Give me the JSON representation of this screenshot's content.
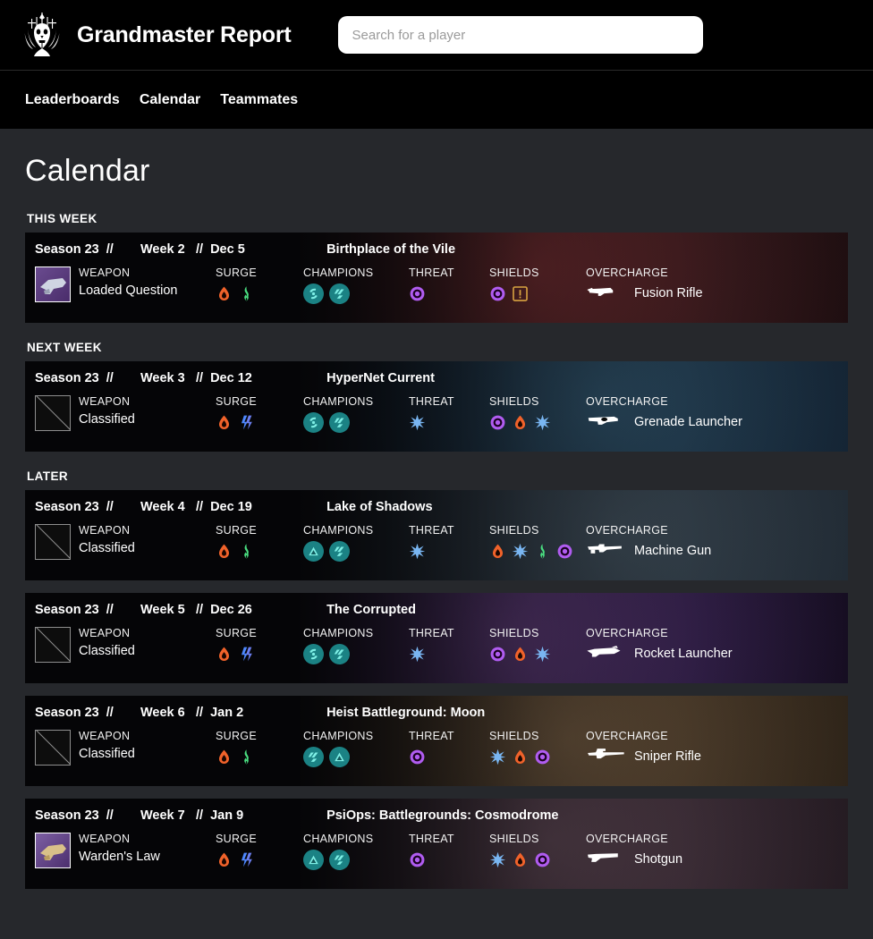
{
  "header": {
    "logo_icon": "grandmaster-crest-icon",
    "brand": "Grandmaster Report",
    "search_placeholder": "Search for a player",
    "search_value": ""
  },
  "nav": {
    "items": [
      {
        "label": "Leaderboards"
      },
      {
        "label": "Calendar"
      },
      {
        "label": "Teammates"
      }
    ]
  },
  "page": {
    "title": "Calendar"
  },
  "labels": {
    "weapon": "WEAPON",
    "surge": "SURGE",
    "champions": "CHAMPIONS",
    "threat": "THREAT",
    "shields": "SHIELDS",
    "overcharge": "OVERCHARGE",
    "separator": "//"
  },
  "colors": {
    "solar": "#f0622a",
    "arc": "#79b6f2",
    "void": "#b05cf0",
    "stasis": "#4d88ff",
    "strand": "#4ade80",
    "champion_badge": "#1b8284",
    "champion_glyph": "#7ff0e6",
    "page_bg": "#26282c",
    "header_bg": "#000000",
    "card_bg": "#090909"
  },
  "sections": [
    {
      "label": "THIS WEEK",
      "cards": [
        {
          "season": "Season 23",
          "week": "Week 2",
          "date": "Dec 5",
          "activity": "Birthplace of the Vile",
          "bg_tone": "maroon",
          "weapon": {
            "name": "Loaded Question",
            "classified": false,
            "art": "art-purple"
          },
          "surge": [
            "solar",
            "strand"
          ],
          "champions": [
            "overload",
            "unstoppable"
          ],
          "threat": [
            "void"
          ],
          "shields": [
            "void",
            "caution"
          ],
          "overcharge": {
            "name": "Fusion Rifle",
            "icon": "fusion-rifle-icon"
          }
        }
      ]
    },
    {
      "label": "NEXT WEEK",
      "cards": [
        {
          "season": "Season 23",
          "week": "Week 3",
          "date": "Dec 12",
          "activity": "HyperNet Current",
          "bg_tone": "teal",
          "weapon": {
            "name": "Classified",
            "classified": true,
            "art": ""
          },
          "surge": [
            "solar",
            "stasis"
          ],
          "champions": [
            "overload",
            "unstoppable"
          ],
          "threat": [
            "arc"
          ],
          "shields": [
            "void",
            "solar",
            "arc"
          ],
          "overcharge": {
            "name": "Grenade Launcher",
            "icon": "grenade-launcher-icon"
          }
        }
      ]
    },
    {
      "label": "LATER",
      "cards": [
        {
          "season": "Season 23",
          "week": "Week 4",
          "date": "Dec 19",
          "activity": "Lake of Shadows",
          "bg_tone": "slate",
          "weapon": {
            "name": "Classified",
            "classified": true,
            "art": ""
          },
          "surge": [
            "solar",
            "strand"
          ],
          "champions": [
            "barrier",
            "unstoppable"
          ],
          "threat": [
            "arc"
          ],
          "shields": [
            "solar",
            "arc",
            "strand",
            "void"
          ],
          "overcharge": {
            "name": "Machine Gun",
            "icon": "machine-gun-icon"
          }
        },
        {
          "season": "Season 23",
          "week": "Week 5",
          "date": "Dec 26",
          "activity": "The Corrupted",
          "bg_tone": "violet",
          "weapon": {
            "name": "Classified",
            "classified": true,
            "art": ""
          },
          "surge": [
            "solar",
            "stasis"
          ],
          "champions": [
            "overload",
            "unstoppable"
          ],
          "threat": [
            "arc"
          ],
          "shields": [
            "void",
            "solar",
            "arc"
          ],
          "overcharge": {
            "name": "Rocket Launcher",
            "icon": "rocket-launcher-icon"
          }
        },
        {
          "season": "Season 23",
          "week": "Week 6",
          "date": "Jan 2",
          "activity": "Heist Battleground: Moon",
          "bg_tone": "brown",
          "weapon": {
            "name": "Classified",
            "classified": true,
            "art": ""
          },
          "surge": [
            "solar",
            "strand"
          ],
          "champions": [
            "unstoppable",
            "barrier"
          ],
          "threat": [
            "void"
          ],
          "shields": [
            "arc",
            "solar",
            "void"
          ],
          "overcharge": {
            "name": "Sniper Rifle",
            "icon": "sniper-rifle-icon"
          }
        },
        {
          "season": "Season 23",
          "week": "Week 7",
          "date": "Jan 9",
          "activity": "PsiOps: Battlegrounds: Cosmodrome",
          "bg_tone": "dusk",
          "weapon": {
            "name": "Warden's Law",
            "classified": false,
            "art": "art-gold"
          },
          "surge": [
            "solar",
            "stasis"
          ],
          "champions": [
            "barrier",
            "unstoppable"
          ],
          "threat": [
            "void"
          ],
          "shields": [
            "arc",
            "solar",
            "void"
          ],
          "overcharge": {
            "name": "Shotgun",
            "icon": "shotgun-icon"
          }
        }
      ]
    }
  ]
}
